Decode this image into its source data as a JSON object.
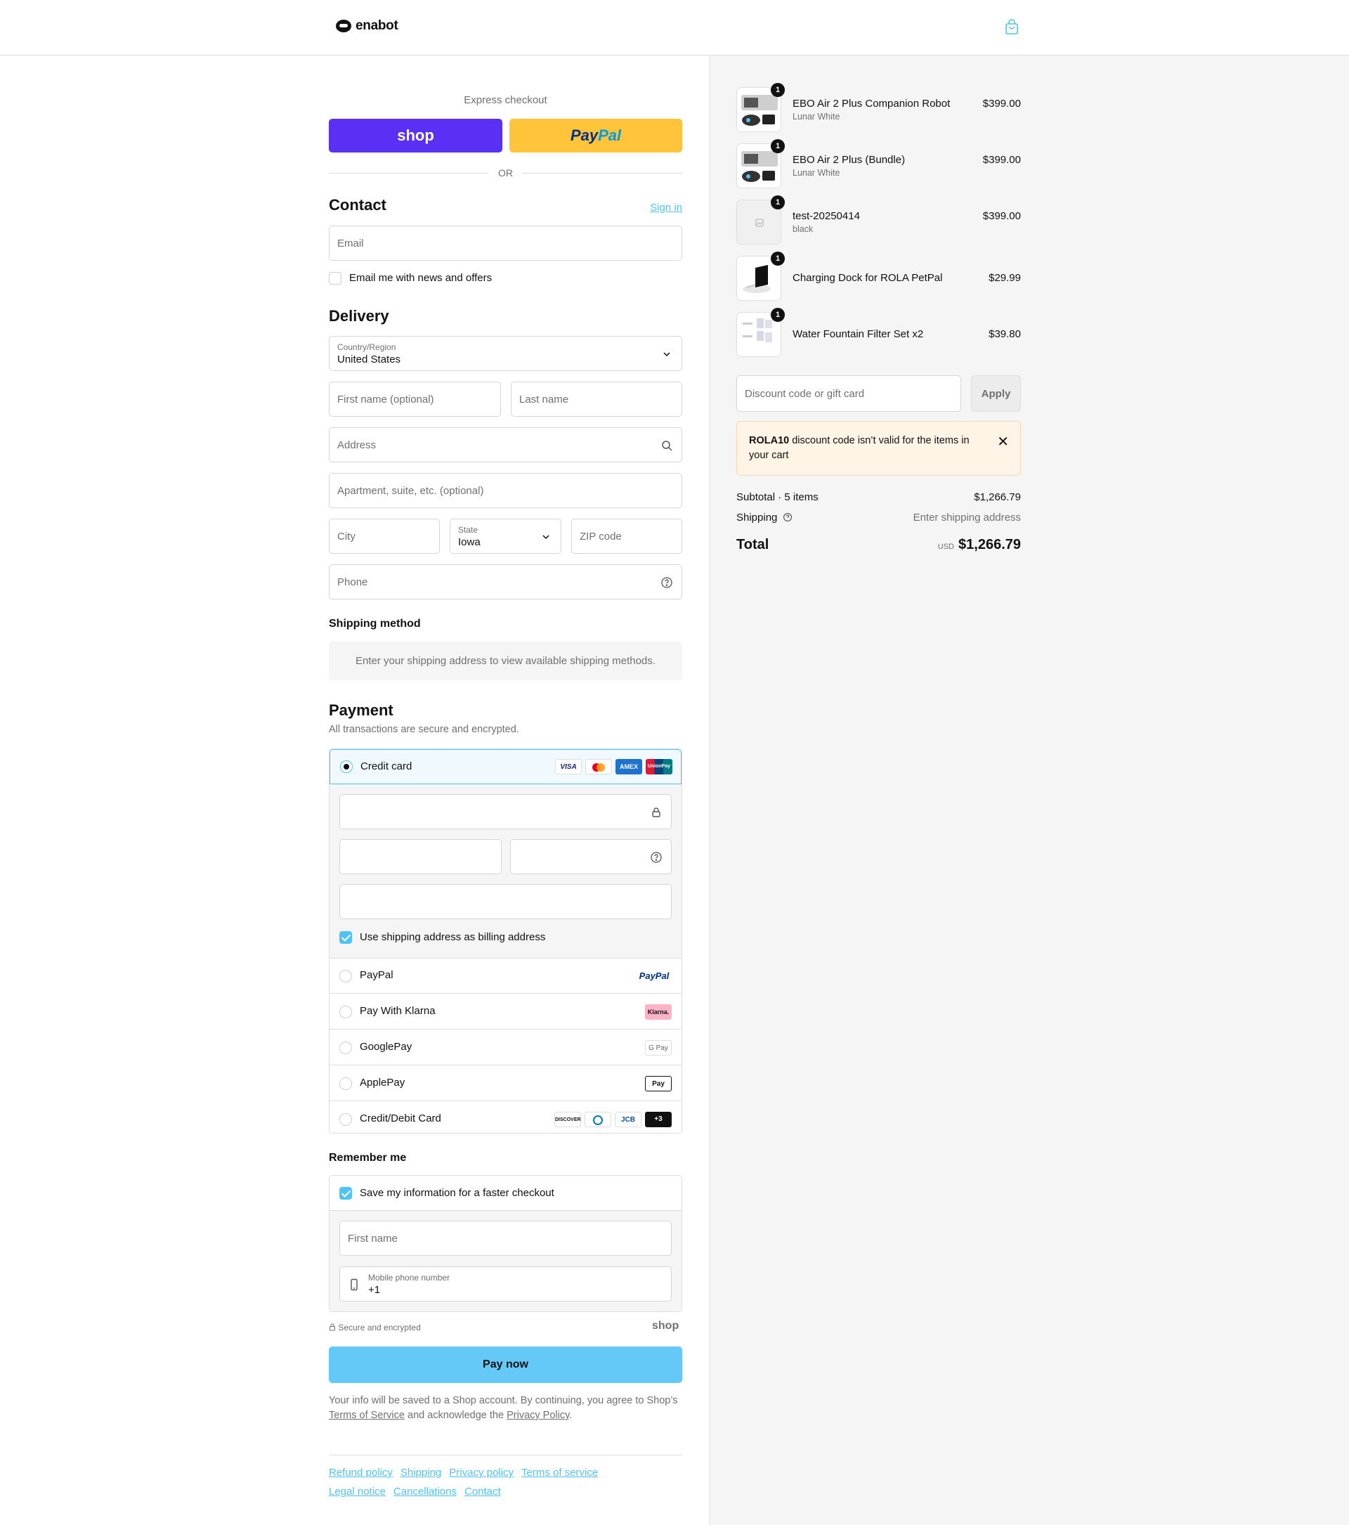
{
  "brand": {
    "name": "enabot"
  },
  "express": {
    "title": "Express checkout",
    "shop_label": "shop",
    "paypal_label_1": "Pay",
    "paypal_label_2": "Pal",
    "or": "OR"
  },
  "contact": {
    "title": "Contact",
    "sign_in": "Sign in",
    "email_placeholder": "Email",
    "news_label": "Email me with news and offers",
    "news_checked": false
  },
  "delivery": {
    "title": "Delivery",
    "country_label": "Country/Region",
    "country_value": "United States",
    "first_name_placeholder": "First name (optional)",
    "last_name_placeholder": "Last name",
    "address_placeholder": "Address",
    "apartment_placeholder": "Apartment, suite, etc. (optional)",
    "city_placeholder": "City",
    "state_label": "State",
    "state_value": "Iowa",
    "zip_placeholder": "ZIP code",
    "phone_placeholder": "Phone"
  },
  "shipping_method": {
    "title": "Shipping method",
    "info": "Enter your shipping address to view available shipping methods."
  },
  "payment": {
    "title": "Payment",
    "subtitle": "All transactions are secure and encrypted.",
    "credit_card_label": "Credit card",
    "billing_label": "Use shipping address as billing address",
    "billing_checked": true,
    "cards": [
      "VISA",
      "",
      "AMEX",
      "UnionPay"
    ],
    "options": [
      {
        "label": "PayPal",
        "badge": "PayPal"
      },
      {
        "label": "Pay With Klarna",
        "badge": "Klarna."
      },
      {
        "label": "GooglePay",
        "badge": "G Pay"
      },
      {
        "label": "ApplePay",
        "badge": "Pay"
      },
      {
        "label": "Credit/Debit Card",
        "badge": "+3"
      }
    ],
    "extra_cards": [
      "DISCOVER",
      "",
      "JCB"
    ]
  },
  "remember": {
    "title": "Remember me",
    "save_label": "Save my information for a faster checkout",
    "save_checked": true,
    "first_name_placeholder": "First name",
    "phone_label": "Mobile phone number",
    "phone_value": "+1"
  },
  "footer_pay": {
    "secure": "Secure and encrypted",
    "shop": "shop",
    "pay_now": "Pay now",
    "legal_1": "Your info will be saved to a Shop account. By continuing, you agree to Shop’s ",
    "terms": "Terms of Service",
    "legal_2": " and acknowledge the ",
    "privacy": "Privacy Policy",
    "legal_3": "."
  },
  "footer_links": [
    "Refund policy",
    "Shipping",
    "Privacy policy",
    "Terms of service",
    "Legal notice",
    "Cancellations",
    "Contact"
  ],
  "cart": {
    "items": [
      {
        "name": "EBO Air 2 Plus Companion Robot",
        "variant": "Lunar White",
        "price": "$399.00",
        "qty": "1"
      },
      {
        "name": "EBO Air 2 Plus (Bundle)",
        "variant": "Lunar White",
        "price": "$399.00",
        "qty": "1"
      },
      {
        "name": "test-20250414",
        "variant": "black",
        "price": "$399.00",
        "qty": "1"
      },
      {
        "name": "Charging Dock for ROLA PetPal",
        "variant": "",
        "price": "$29.99",
        "qty": "1"
      },
      {
        "name": "Water Fountain Filter Set x2",
        "variant": "",
        "price": "$39.80",
        "qty": "1"
      }
    ],
    "discount_placeholder": "Discount code or gift card",
    "apply": "Apply",
    "alert_code": "ROLA10",
    "alert_msg": " discount code isn’t valid for the items in your cart",
    "subtotal_label": "Subtotal · 5 items",
    "subtotal_value": "$1,266.79",
    "shipping_label": "Shipping",
    "shipping_value": "Enter shipping address",
    "total_label": "Total",
    "currency": "USD",
    "total_value": "$1,266.79"
  }
}
